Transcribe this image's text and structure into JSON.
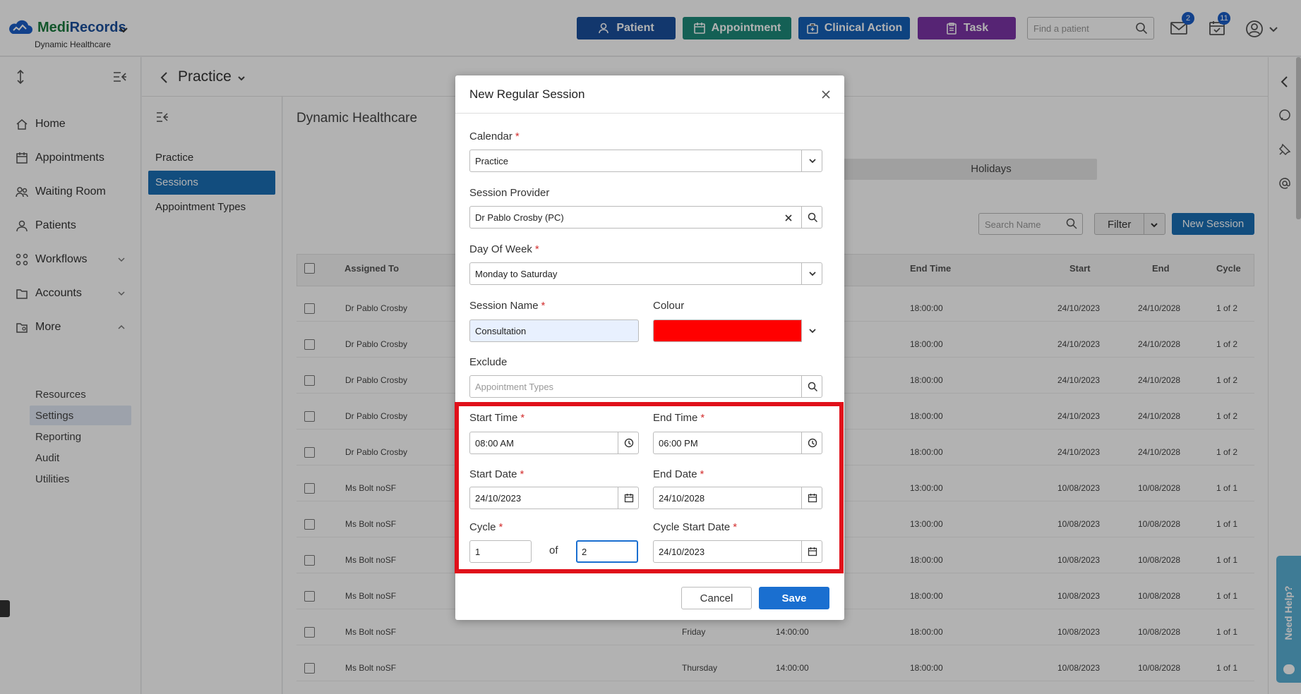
{
  "header": {
    "logo_medi": "Medi",
    "logo_records": "Records",
    "logo_sub": "Dynamic Healthcare",
    "buttons": {
      "patient": "Patient",
      "appointment": "Appointment",
      "clinical_action": "Clinical Action",
      "task": "Task"
    },
    "search_placeholder": "Find a patient",
    "mail_count": "2",
    "tasks_count": "11",
    "colors": {
      "patient": "#1a4f9c",
      "appointment": "#1d8a7a",
      "clinical_action": "#1560b8",
      "task": "#7b34a6"
    }
  },
  "sidebar": {
    "items": [
      "Home",
      "Appointments",
      "Waiting Room",
      "Patients",
      "Workflows",
      "Accounts",
      "More"
    ],
    "more_sub": [
      "Resources",
      "Settings",
      "Reporting",
      "Audit",
      "Utilities"
    ]
  },
  "page": {
    "breadcrumb": "Practice",
    "sub_nav": [
      "Practice",
      "Sessions",
      "Appointment Types"
    ],
    "title": "Dynamic Healthcare",
    "holidays_tab": "Holidays",
    "search_placeholder": "Search Name",
    "filter_label": "Filter",
    "new_session_label": "New Session",
    "columns": {
      "assigned_to": "Assigned To",
      "end_time": "End Time",
      "start": "Start",
      "end": "End",
      "cycle": "Cycle"
    },
    "rows": [
      {
        "assigned": "Dr Pablo Crosby",
        "day": "",
        "start_time": "",
        "end_time": "18:00:00",
        "start": "24/10/2023",
        "end": "24/10/2028",
        "cycle": "1 of 2"
      },
      {
        "assigned": "Dr Pablo Crosby",
        "day": "",
        "start_time": "",
        "end_time": "18:00:00",
        "start": "24/10/2023",
        "end": "24/10/2028",
        "cycle": "1 of 2"
      },
      {
        "assigned": "Dr Pablo Crosby",
        "day": "",
        "start_time": "",
        "end_time": "18:00:00",
        "start": "24/10/2023",
        "end": "24/10/2028",
        "cycle": "1 of 2"
      },
      {
        "assigned": "Dr Pablo Crosby",
        "day": "",
        "start_time": "",
        "end_time": "18:00:00",
        "start": "24/10/2023",
        "end": "24/10/2028",
        "cycle": "1 of 2"
      },
      {
        "assigned": "Dr Pablo Crosby",
        "day": "",
        "start_time": "",
        "end_time": "18:00:00",
        "start": "24/10/2023",
        "end": "24/10/2028",
        "cycle": "1 of 2"
      },
      {
        "assigned": "Ms Bolt noSF",
        "day": "",
        "start_time": "",
        "end_time": "13:00:00",
        "start": "10/08/2023",
        "end": "10/08/2028",
        "cycle": "1 of 1"
      },
      {
        "assigned": "Ms Bolt noSF",
        "day": "",
        "start_time": "",
        "end_time": "13:00:00",
        "start": "10/08/2023",
        "end": "10/08/2028",
        "cycle": "1 of 1"
      },
      {
        "assigned": "Ms Bolt noSF",
        "day": "",
        "start_time": "",
        "end_time": "18:00:00",
        "start": "10/08/2023",
        "end": "10/08/2028",
        "cycle": "1 of 1"
      },
      {
        "assigned": "Ms Bolt noSF",
        "day": "",
        "start_time": "",
        "end_time": "18:00:00",
        "start": "10/08/2023",
        "end": "10/08/2028",
        "cycle": "1 of 1"
      },
      {
        "assigned": "Ms Bolt noSF",
        "day": "Friday",
        "start_time": "14:00:00",
        "end_time": "18:00:00",
        "start": "10/08/2023",
        "end": "10/08/2028",
        "cycle": "1 of 1"
      },
      {
        "assigned": "Ms Bolt noSF",
        "day": "Thursday",
        "start_time": "14:00:00",
        "end_time": "18:00:00",
        "start": "10/08/2023",
        "end": "10/08/2028",
        "cycle": "1 of 1"
      }
    ]
  },
  "modal": {
    "title": "New Regular Session",
    "calendar_label": "Calendar",
    "calendar_value": "Practice",
    "provider_label": "Session Provider",
    "provider_value": "Dr Pablo Crosby (PC)",
    "day_label": "Day Of Week",
    "day_value": "Monday to Saturday",
    "session_name_label": "Session Name",
    "session_name_value": "Consultation",
    "colour_label": "Colour",
    "colour_value": "#ff0000",
    "exclude_label": "Exclude",
    "exclude_placeholder": "Appointment Types",
    "start_time_label": "Start Time",
    "start_time_value": "08:00 AM",
    "end_time_label": "End Time",
    "end_time_value": "06:00 PM",
    "start_date_label": "Start Date",
    "start_date_value": "24/10/2023",
    "end_date_label": "End Date",
    "end_date_value": "24/10/2028",
    "cycle_label": "Cycle",
    "cycle_value": "1",
    "of_label": "of",
    "cycle_of_value": "2",
    "cycle_start_label": "Cycle Start Date",
    "cycle_start_value": "24/10/2023",
    "required_mark": "*",
    "cancel_label": "Cancel",
    "save_label": "Save"
  },
  "help_tab": "Need Help?"
}
